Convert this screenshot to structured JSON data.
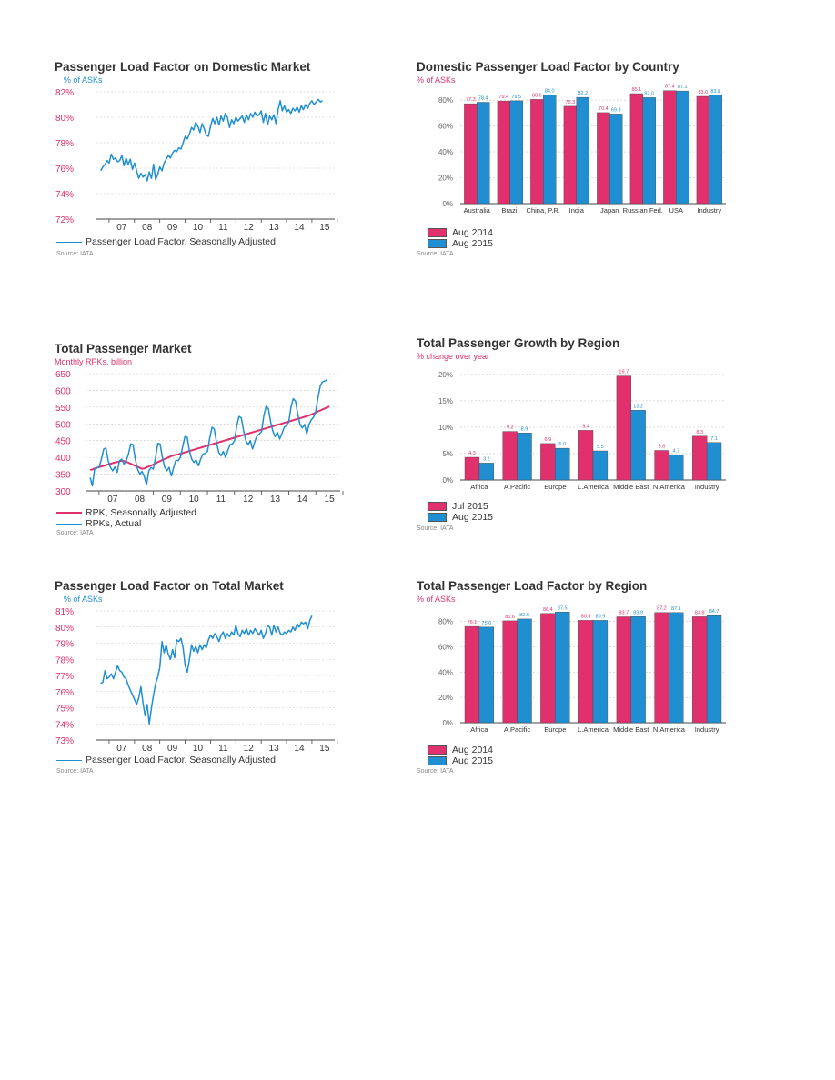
{
  "colors": {
    "pink": "#e0306e",
    "blue": "#1f8fd1",
    "grid": "#c8c8c8",
    "axis": "#444444"
  },
  "source_text": "Source: IATA",
  "chart_data": [
    {
      "id": "domestic_plf",
      "type": "line",
      "title": "Passenger Load Factor on Domestic Market",
      "ylabel": "% of ASKs",
      "ylim": [
        72,
        82
      ],
      "yticks": [
        "72%",
        "74%",
        "76%",
        "78%",
        "80%",
        "82%"
      ],
      "xlim": [
        2006.5,
        2015.9
      ],
      "xticks": [
        "07",
        "08",
        "09",
        "10",
        "11",
        "12",
        "13",
        "14",
        "15"
      ],
      "grid": true,
      "series": [
        {
          "name": "Passenger Load Factor, Seasonally Adjusted",
          "color": "blue",
          "x_start": 2006.67,
          "x_step": 0.0833,
          "values": [
            75.8,
            76.1,
            76.3,
            76.6,
            76.4,
            77.1,
            76.7,
            76.8,
            76.5,
            76.6,
            77.0,
            76.2,
            76.8,
            76.3,
            76.7,
            75.9,
            76.4,
            75.8,
            75.2,
            75.6,
            75.3,
            75.5,
            75.0,
            75.7,
            75.2,
            76.3,
            75.1,
            75.5,
            76.1,
            75.8,
            76.4,
            76.7,
            77.0,
            76.8,
            77.2,
            77.4,
            77.3,
            77.6,
            77.5,
            78.0,
            78.5,
            78.3,
            78.7,
            79.2,
            79.0,
            79.6,
            79.3,
            78.8,
            79.5,
            79.1,
            78.6,
            78.5,
            79.3,
            79.9,
            79.5,
            80.0,
            79.4,
            80.1,
            79.7,
            80.3,
            80.0,
            79.2,
            79.8,
            79.5,
            80.0,
            79.7,
            79.9,
            80.1,
            79.6,
            80.2,
            79.8,
            80.3,
            80.0,
            80.4,
            80.1,
            80.2,
            80.5,
            79.6,
            80.3,
            79.4,
            80.1,
            79.8,
            80.2,
            79.5,
            80.6,
            81.3,
            80.5,
            80.9,
            80.4,
            80.6,
            80.3,
            80.7,
            80.5,
            80.8,
            80.4,
            80.9,
            80.6,
            81.0,
            80.7,
            81.1,
            81.3,
            81.0,
            81.2,
            81.4,
            81.2,
            81.3
          ]
        }
      ]
    },
    {
      "id": "domestic_by_country",
      "type": "bar",
      "title": "Domestic Passenger Load Factor by Country",
      "ylabel": "% of ASKs",
      "ylim": [
        0,
        90
      ],
      "yticks": [
        "0%",
        "20%",
        "40%",
        "60%",
        "80%"
      ],
      "categories": [
        "Australia",
        "Brazil",
        "China, P.R.",
        "India",
        "Japan",
        "Russian Fed.",
        "USA",
        "Industry"
      ],
      "series": [
        {
          "name": "Aug 2014",
          "color": "pink",
          "values": [
            77.3,
            79.4,
            80.6,
            75.3,
            70.4,
            85.1,
            87.4,
            83.0
          ],
          "labels": [
            "77.3",
            "79.4",
            "80.6",
            "75.3",
            "70.4",
            "85.1",
            "87.4",
            "83.0"
          ]
        },
        {
          "name": "Aug 2015",
          "color": "blue",
          "values": [
            78.4,
            79.5,
            84.0,
            82.2,
            69.3,
            82.0,
            87.1,
            83.8
          ],
          "labels": [
            "78.4",
            "79.5",
            "84.0",
            "82.2",
            "69.3",
            "82.0",
            "87.1",
            "83.8"
          ]
        }
      ],
      "legend": "bottom-left"
    },
    {
      "id": "total_market",
      "type": "line",
      "title": "Total Passenger Market",
      "ylabel": "Monthly RPKs, billion",
      "ylim": [
        300,
        650
      ],
      "yticks": [
        "300",
        "350",
        "400",
        "450",
        "500",
        "550",
        "600",
        "650"
      ],
      "xlim": [
        2006.5,
        2015.9
      ],
      "xticks": [
        "07",
        "08",
        "09",
        "10",
        "11",
        "12",
        "13",
        "14",
        "15"
      ],
      "grid": true,
      "series": [
        {
          "name": "RPK, Seasonally Adjusted",
          "color": "pink",
          "x_start": 2006.67,
          "x_step": 0.0833,
          "values": [
            362,
            364,
            367,
            369,
            371,
            373,
            375,
            377,
            379,
            381,
            383,
            385,
            386,
            388,
            390,
            389,
            387,
            384,
            381,
            378,
            375,
            372,
            369,
            366,
            367,
            370,
            373,
            376,
            379,
            382,
            386,
            389,
            392,
            395,
            398,
            401,
            404,
            406,
            408,
            409,
            411,
            413,
            415,
            417,
            419,
            421,
            423,
            425,
            427,
            429,
            431,
            433,
            435,
            437,
            439,
            441,
            443,
            445,
            447,
            449,
            451,
            453,
            455,
            457,
            459,
            461,
            463,
            465,
            467,
            469,
            471,
            473,
            475,
            477,
            479,
            481,
            483,
            485,
            487,
            489,
            491,
            493,
            495,
            497,
            499,
            501,
            503,
            505,
            507,
            509,
            511,
            513,
            515,
            517,
            519,
            521,
            523,
            525,
            528,
            531,
            534,
            537,
            540,
            543,
            546,
            549,
            552
          ]
        },
        {
          "name": "RPKs, Actual",
          "color": "blue",
          "x_start": 2006.67,
          "x_step": 0.0833,
          "values": [
            340,
            315,
            365,
            368,
            372,
            395,
            425,
            428,
            390,
            370,
            360,
            372,
            355,
            390,
            395,
            380,
            390,
            410,
            440,
            438,
            395,
            365,
            350,
            358,
            343,
            318,
            360,
            370,
            365,
            400,
            442,
            440,
            400,
            372,
            360,
            370,
            345,
            370,
            392,
            390,
            400,
            432,
            462,
            460,
            420,
            395,
            385,
            392,
            375,
            395,
            410,
            412,
            418,
            458,
            490,
            485,
            445,
            415,
            405,
            418,
            400,
            420,
            438,
            440,
            450,
            495,
            522,
            518,
            480,
            450,
            438,
            450,
            425,
            448,
            465,
            470,
            478,
            525,
            552,
            545,
            505,
            478,
            462,
            475,
            455,
            472,
            490,
            495,
            505,
            550,
            575,
            568,
            530,
            498,
            488,
            498,
            470,
            498,
            512,
            520,
            538,
            580,
            615,
            625,
            628,
            632
          ]
        }
      ]
    },
    {
      "id": "growth_by_region",
      "type": "bar",
      "title": "Total Passenger Growth by Region",
      "ylabel": "% change over year",
      "ylim": [
        0,
        21
      ],
      "yticks": [
        "0%",
        "5%",
        "10%",
        "15%",
        "20%"
      ],
      "categories": [
        "Africa",
        "A.Pacific",
        "Europe",
        "L.America",
        "Middle East",
        "N.America",
        "Industry"
      ],
      "series": [
        {
          "name": "Jul 2015",
          "color": "pink",
          "values": [
            4.3,
            9.2,
            6.9,
            9.4,
            19.7,
            5.6,
            8.3
          ],
          "labels": [
            "4.3",
            "9.2",
            "6.9",
            "9.4",
            "19.7",
            "5.6",
            "8.3"
          ]
        },
        {
          "name": "Aug 2015",
          "color": "blue",
          "values": [
            3.2,
            8.9,
            6.0,
            5.5,
            13.2,
            4.7,
            7.1
          ],
          "labels": [
            "3.2",
            "8.9",
            "6.0",
            "5.5",
            "13.2",
            "4.7",
            "7.1"
          ]
        }
      ],
      "legend": "bottom-left"
    },
    {
      "id": "total_plf",
      "type": "line",
      "title": "Passenger Load Factor on Total Market",
      "ylabel": "% of ASKs",
      "ylim": [
        73,
        81
      ],
      "yticks": [
        "73%",
        "74%",
        "75%",
        "76%",
        "77%",
        "78%",
        "79%",
        "80%",
        "81%"
      ],
      "xlim": [
        2006.5,
        2015.9
      ],
      "xticks": [
        "07",
        "08",
        "09",
        "10",
        "11",
        "12",
        "13",
        "14",
        "15"
      ],
      "grid": true,
      "series": [
        {
          "name": "Passenger Load Factor, Seasonally Adjusted",
          "color": "blue",
          "x_start": 2006.67,
          "x_step": 0.0833,
          "values": [
            76.5,
            76.6,
            77.3,
            76.8,
            76.9,
            77.1,
            76.8,
            77.2,
            77.6,
            77.3,
            77.2,
            76.9,
            76.8,
            76.4,
            76.1,
            75.8,
            75.5,
            75.2,
            75.6,
            76.3,
            75.3,
            74.5,
            75.2,
            74.0,
            75.0,
            75.8,
            76.5,
            76.9,
            77.5,
            79.1,
            78.4,
            78.9,
            78.3,
            78.0,
            78.6,
            78.1,
            79.2,
            79.1,
            79.3,
            78.7,
            77.6,
            77.2,
            78.0,
            78.9,
            78.5,
            78.8,
            78.4,
            78.9,
            78.6,
            78.9,
            78.7,
            79.2,
            79.5,
            79.3,
            79.6,
            79.4,
            79.1,
            79.5,
            79.7,
            79.3,
            79.6,
            79.4,
            79.7,
            79.5,
            80.1,
            79.6,
            79.4,
            79.8,
            79.6,
            79.9,
            79.5,
            79.8,
            79.6,
            79.9,
            79.7,
            79.5,
            79.8,
            79.3,
            79.6,
            80.1,
            80.0,
            79.5,
            80.1,
            79.7,
            80.0,
            79.6,
            79.5,
            79.7,
            79.6,
            79.8,
            79.7,
            80.0,
            79.8,
            80.2,
            80.0,
            80.3,
            80.2,
            80.3,
            79.9,
            80.4,
            80.7
          ]
        }
      ]
    },
    {
      "id": "plf_by_region",
      "type": "bar",
      "title": "Total Passenger Load Factor by Region",
      "ylabel": "% of ASKs",
      "ylim": [
        0,
        92
      ],
      "yticks": [
        "0%",
        "20%",
        "40%",
        "60%",
        "80%"
      ],
      "categories": [
        "Africa",
        "A.Pacific",
        "Europe",
        "L.America",
        "Middle East",
        "N.America",
        "Industry"
      ],
      "series": [
        {
          "name": "Aug 2014",
          "color": "pink",
          "values": [
            76.1,
            80.6,
            86.4,
            80.9,
            83.7,
            87.2,
            83.8
          ],
          "labels": [
            "76.1",
            "80.6",
            "86.4",
            "80.9",
            "83.7",
            "87.2",
            "83.8"
          ]
        },
        {
          "name": "Aug 2015",
          "color": "blue",
          "values": [
            75.6,
            82.0,
            87.5,
            80.9,
            83.9,
            87.1,
            84.7
          ],
          "labels": [
            "75.6",
            "82.0",
            "87.5",
            "80.9",
            "83.9",
            "87.1",
            "84.7"
          ]
        }
      ],
      "legend": "bottom-left"
    }
  ]
}
